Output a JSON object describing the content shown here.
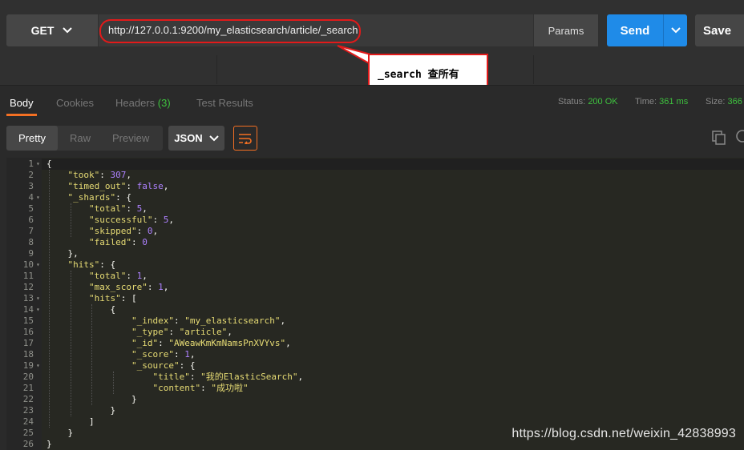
{
  "request": {
    "method": "GET",
    "url": "http://127.0.0.1:9200/my_elasticsearch/article/_search",
    "params_label": "Params",
    "send_label": "Send",
    "save_label": "Save"
  },
  "annotation": {
    "text": "_search 查所有"
  },
  "response_tabs": {
    "body": "Body",
    "cookies": "Cookies",
    "headers": "Headers",
    "headers_count": "(3)",
    "test_results": "Test Results"
  },
  "status": {
    "status_label": "Status:",
    "status_value": "200 OK",
    "time_label": "Time:",
    "time_value": "361 ms",
    "size_label": "Size:",
    "size_value": "366"
  },
  "view": {
    "pretty": "Pretty",
    "raw": "Raw",
    "preview": "Preview",
    "format": "JSON"
  },
  "code_lines": [
    {
      "n": "1",
      "fold": true,
      "indent": 0,
      "parts": [
        [
          "p",
          "{"
        ]
      ]
    },
    {
      "n": "2",
      "indent": 1,
      "parts": [
        [
          "k",
          "\"took\""
        ],
        [
          "p",
          ": "
        ],
        [
          "n",
          "307"
        ],
        [
          "p",
          ","
        ]
      ]
    },
    {
      "n": "3",
      "indent": 1,
      "parts": [
        [
          "k",
          "\"timed_out\""
        ],
        [
          "p",
          ": "
        ],
        [
          "n",
          "false"
        ],
        [
          "p",
          ","
        ]
      ]
    },
    {
      "n": "4",
      "fold": true,
      "indent": 1,
      "parts": [
        [
          "k",
          "\"_shards\""
        ],
        [
          "p",
          ": {"
        ]
      ]
    },
    {
      "n": "5",
      "indent": 2,
      "parts": [
        [
          "k",
          "\"total\""
        ],
        [
          "p",
          ": "
        ],
        [
          "n",
          "5"
        ],
        [
          "p",
          ","
        ]
      ]
    },
    {
      "n": "6",
      "indent": 2,
      "parts": [
        [
          "k",
          "\"successful\""
        ],
        [
          "p",
          ": "
        ],
        [
          "n",
          "5"
        ],
        [
          "p",
          ","
        ]
      ]
    },
    {
      "n": "7",
      "indent": 2,
      "parts": [
        [
          "k",
          "\"skipped\""
        ],
        [
          "p",
          ": "
        ],
        [
          "n",
          "0"
        ],
        [
          "p",
          ","
        ]
      ]
    },
    {
      "n": "8",
      "indent": 2,
      "parts": [
        [
          "k",
          "\"failed\""
        ],
        [
          "p",
          ": "
        ],
        [
          "n",
          "0"
        ]
      ]
    },
    {
      "n": "9",
      "indent": 1,
      "parts": [
        [
          "p",
          "},"
        ]
      ]
    },
    {
      "n": "10",
      "fold": true,
      "indent": 1,
      "parts": [
        [
          "k",
          "\"hits\""
        ],
        [
          "p",
          ": {"
        ]
      ]
    },
    {
      "n": "11",
      "indent": 2,
      "parts": [
        [
          "k",
          "\"total\""
        ],
        [
          "p",
          ": "
        ],
        [
          "n",
          "1"
        ],
        [
          "p",
          ","
        ]
      ]
    },
    {
      "n": "12",
      "indent": 2,
      "parts": [
        [
          "k",
          "\"max_score\""
        ],
        [
          "p",
          ": "
        ],
        [
          "n",
          "1"
        ],
        [
          "p",
          ","
        ]
      ]
    },
    {
      "n": "13",
      "fold": true,
      "indent": 2,
      "parts": [
        [
          "k",
          "\"hits\""
        ],
        [
          "p",
          ": ["
        ]
      ]
    },
    {
      "n": "14",
      "fold": true,
      "indent": 3,
      "parts": [
        [
          "p",
          "{"
        ]
      ]
    },
    {
      "n": "15",
      "indent": 4,
      "parts": [
        [
          "k",
          "\"_index\""
        ],
        [
          "p",
          ": "
        ],
        [
          "s",
          "\"my_elasticsearch\""
        ],
        [
          "p",
          ","
        ]
      ]
    },
    {
      "n": "16",
      "indent": 4,
      "parts": [
        [
          "k",
          "\"_type\""
        ],
        [
          "p",
          ": "
        ],
        [
          "s",
          "\"article\""
        ],
        [
          "p",
          ","
        ]
      ]
    },
    {
      "n": "17",
      "indent": 4,
      "parts": [
        [
          "k",
          "\"_id\""
        ],
        [
          "p",
          ": "
        ],
        [
          "s",
          "\"AWeawKmKmNamsPnXVYvs\""
        ],
        [
          "p",
          ","
        ]
      ]
    },
    {
      "n": "18",
      "indent": 4,
      "parts": [
        [
          "k",
          "\"_score\""
        ],
        [
          "p",
          ": "
        ],
        [
          "n",
          "1"
        ],
        [
          "p",
          ","
        ]
      ]
    },
    {
      "n": "19",
      "fold": true,
      "indent": 4,
      "parts": [
        [
          "k",
          "\"_source\""
        ],
        [
          "p",
          ": {"
        ]
      ]
    },
    {
      "n": "20",
      "indent": 5,
      "parts": [
        [
          "k",
          "\"title\""
        ],
        [
          "p",
          ": "
        ],
        [
          "s",
          "\"我的ElasticSearch\""
        ],
        [
          "p",
          ","
        ]
      ]
    },
    {
      "n": "21",
      "indent": 5,
      "parts": [
        [
          "k",
          "\"content\""
        ],
        [
          "p",
          ": "
        ],
        [
          "s",
          "\"成功啦\""
        ]
      ]
    },
    {
      "n": "22",
      "indent": 4,
      "parts": [
        [
          "p",
          "}"
        ]
      ]
    },
    {
      "n": "23",
      "indent": 3,
      "parts": [
        [
          "p",
          "}"
        ]
      ]
    },
    {
      "n": "24",
      "indent": 2,
      "parts": [
        [
          "p",
          "]"
        ]
      ]
    },
    {
      "n": "25",
      "indent": 1,
      "parts": [
        [
          "p",
          "}"
        ]
      ]
    },
    {
      "n": "26",
      "indent": 0,
      "parts": [
        [
          "p",
          "}"
        ]
      ]
    }
  ],
  "watermark": "https://blog.csdn.net/weixin_42838993",
  "colors": {
    "accent": "#f47023",
    "send": "#1f8be8",
    "status_ok": "#3ec13e",
    "callout_border": "#e21a1a"
  }
}
